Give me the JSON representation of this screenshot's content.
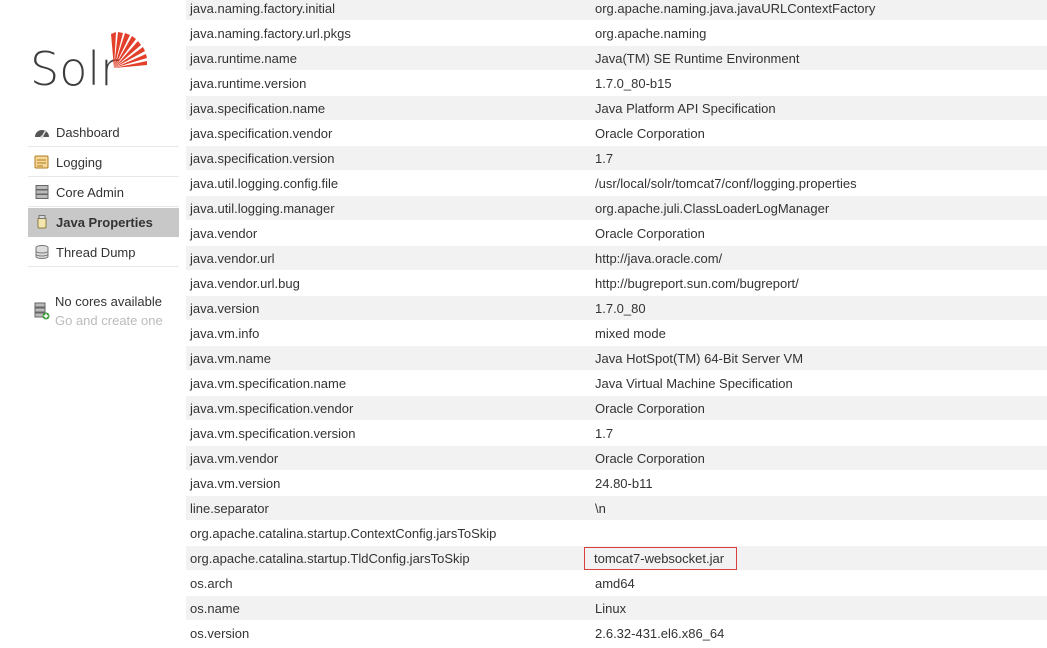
{
  "app": {
    "logo_text": "Solr",
    "brand_color": "#e2402b"
  },
  "sidebar": {
    "items": [
      {
        "label": "Dashboard",
        "icon": "dashboard-icon",
        "selected": false
      },
      {
        "label": "Logging",
        "icon": "logging-icon",
        "selected": false
      },
      {
        "label": "Core Admin",
        "icon": "core-admin-icon",
        "selected": false
      },
      {
        "label": "Java Properties",
        "icon": "java-properties-icon",
        "selected": true
      },
      {
        "label": "Thread Dump",
        "icon": "thread-dump-icon",
        "selected": false
      }
    ],
    "cores": {
      "title": "No cores available",
      "link": "Go and create one"
    }
  },
  "properties": [
    {
      "key": "java.naming.factory.initial",
      "value": "org.apache.naming.java.javaURLContextFactory"
    },
    {
      "key": "java.naming.factory.url.pkgs",
      "value": "org.apache.naming"
    },
    {
      "key": "java.runtime.name",
      "value": "Java(TM) SE Runtime Environment"
    },
    {
      "key": "java.runtime.version",
      "value": "1.7.0_80-b15"
    },
    {
      "key": "java.specification.name",
      "value": "Java Platform API Specification"
    },
    {
      "key": "java.specification.vendor",
      "value": "Oracle Corporation"
    },
    {
      "key": "java.specification.version",
      "value": "1.7"
    },
    {
      "key": "java.util.logging.config.file",
      "value": "/usr/local/solr/tomcat7/conf/logging.properties"
    },
    {
      "key": "java.util.logging.manager",
      "value": "org.apache.juli.ClassLoaderLogManager"
    },
    {
      "key": "java.vendor",
      "value": "Oracle Corporation"
    },
    {
      "key": "java.vendor.url",
      "value": "http://java.oracle.com/"
    },
    {
      "key": "java.vendor.url.bug",
      "value": "http://bugreport.sun.com/bugreport/"
    },
    {
      "key": "java.version",
      "value": "1.7.0_80"
    },
    {
      "key": "java.vm.info",
      "value": "mixed mode"
    },
    {
      "key": "java.vm.name",
      "value": "Java HotSpot(TM) 64-Bit Server VM"
    },
    {
      "key": "java.vm.specification.name",
      "value": "Java Virtual Machine Specification"
    },
    {
      "key": "java.vm.specification.vendor",
      "value": "Oracle Corporation"
    },
    {
      "key": "java.vm.specification.version",
      "value": "1.7"
    },
    {
      "key": "java.vm.vendor",
      "value": "Oracle Corporation"
    },
    {
      "key": "java.vm.version",
      "value": "24.80-b11"
    },
    {
      "key": "line.separator",
      "value": "\\n"
    },
    {
      "key": "org.apache.catalina.startup.ContextConfig.jarsToSkip",
      "value": ""
    },
    {
      "key": "org.apache.catalina.startup.TldConfig.jarsToSkip",
      "value": "tomcat7-websocket.jar",
      "highlighted": true
    },
    {
      "key": "os.arch",
      "value": "amd64"
    },
    {
      "key": "os.name",
      "value": "Linux"
    },
    {
      "key": "os.version",
      "value": "2.6.32-431.el6.x86_64"
    }
  ]
}
